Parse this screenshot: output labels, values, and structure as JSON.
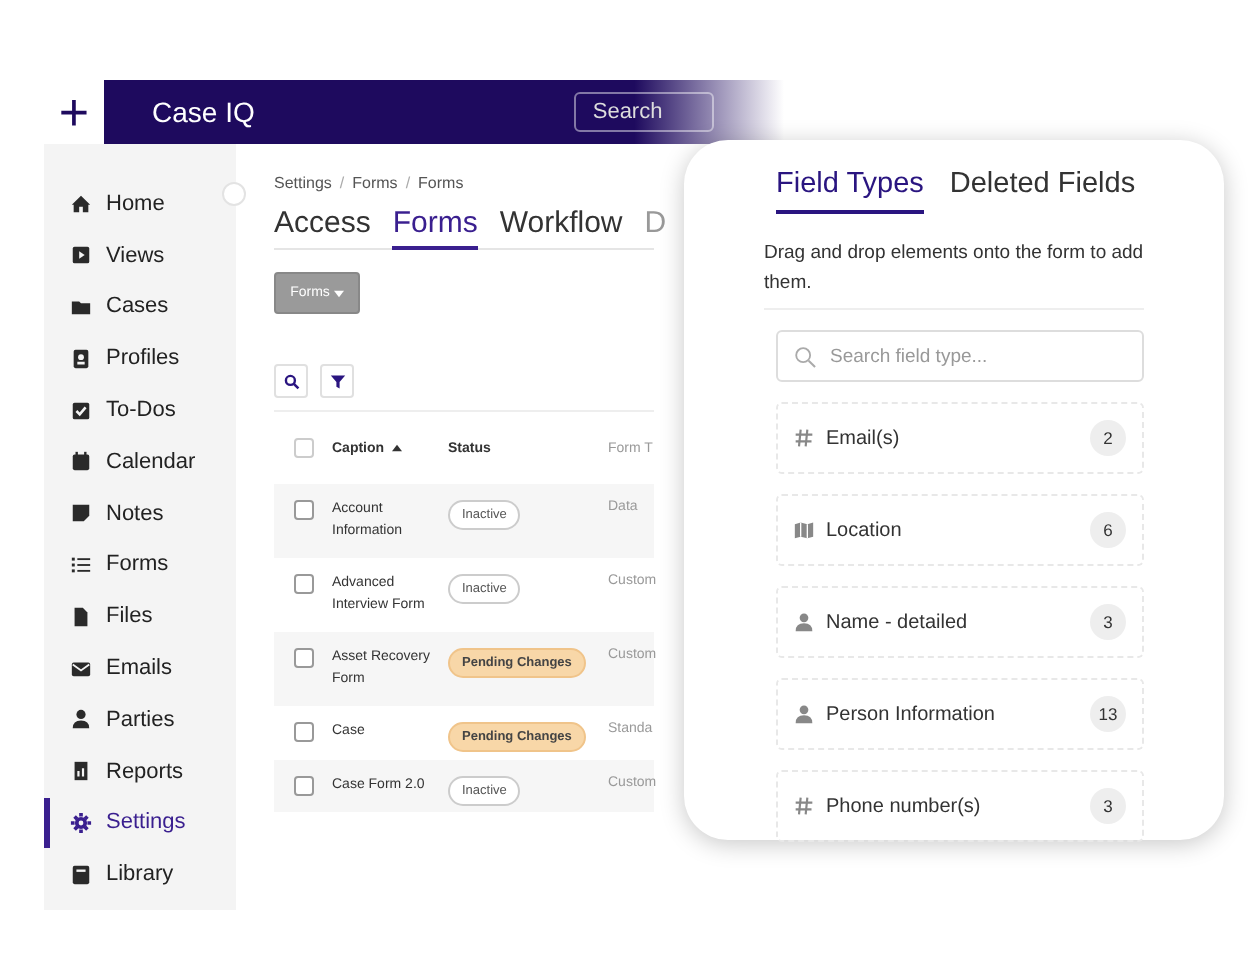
{
  "topbar": {
    "add_symbol": "+",
    "brand": "Case IQ",
    "search_placeholder": "Search"
  },
  "sidebar": {
    "items": [
      {
        "label": "Home",
        "selected": false
      },
      {
        "label": "Views",
        "selected": false
      },
      {
        "label": "Cases",
        "selected": false
      },
      {
        "label": "Profiles",
        "selected": false
      },
      {
        "label": "To-Dos",
        "selected": false
      },
      {
        "label": "Calendar",
        "selected": false
      },
      {
        "label": "Notes",
        "selected": false
      },
      {
        "label": "Forms",
        "selected": false
      },
      {
        "label": "Files",
        "selected": false
      },
      {
        "label": "Emails",
        "selected": false
      },
      {
        "label": "Parties",
        "selected": false
      },
      {
        "label": "Reports",
        "selected": false
      },
      {
        "label": "Settings",
        "selected": true
      },
      {
        "label": "Library",
        "selected": false
      }
    ]
  },
  "breadcrumb": {
    "items": [
      "Settings",
      "Forms",
      "Forms"
    ],
    "separator": "/"
  },
  "tabs": [
    {
      "label": "Access",
      "selected": false
    },
    {
      "label": "Forms",
      "selected": true
    },
    {
      "label": "Workflow",
      "selected": false
    },
    {
      "label": "D",
      "selected": false
    }
  ],
  "forms_dropdown": "Forms",
  "table": {
    "select_all_checked": false,
    "columns": [
      "Caption",
      "Status",
      "Form T"
    ],
    "rows": [
      {
        "caption": "Account Information",
        "status": "Inactive",
        "kind": "inactive",
        "form_type": "Data",
        "checked": false
      },
      {
        "caption": "Advanced Interview Form",
        "status": "Inactive",
        "kind": "inactive",
        "form_type": "Custom",
        "checked": false
      },
      {
        "caption": "Asset Recovery Form",
        "status": "Pending Changes",
        "kind": "pending",
        "form_type": "Custom",
        "checked": false
      },
      {
        "caption": "Case",
        "status": "Pending Changes",
        "kind": "pending",
        "form_type": "Standa",
        "checked": false
      },
      {
        "caption": "Case Form 2.0",
        "status": "Inactive",
        "kind": "inactive",
        "form_type": "Custom",
        "checked": false
      }
    ]
  },
  "panel": {
    "tabs": [
      {
        "label": "Field Types",
        "selected": true
      },
      {
        "label": "Deleted Fields",
        "selected": false
      }
    ],
    "description": "Drag and drop elements onto the form to add them.",
    "search_placeholder": "Search field type...",
    "fields": [
      {
        "label": "Email(s)",
        "kind": "hash",
        "count": "2"
      },
      {
        "label": "Location",
        "kind": "map",
        "count": "6"
      },
      {
        "label": "Name - detailed",
        "kind": "person",
        "count": "3"
      },
      {
        "label": "Person Information",
        "kind": "person",
        "count": "13"
      },
      {
        "label": "Phone number(s)",
        "kind": "hash",
        "count": "3"
      }
    ]
  }
}
